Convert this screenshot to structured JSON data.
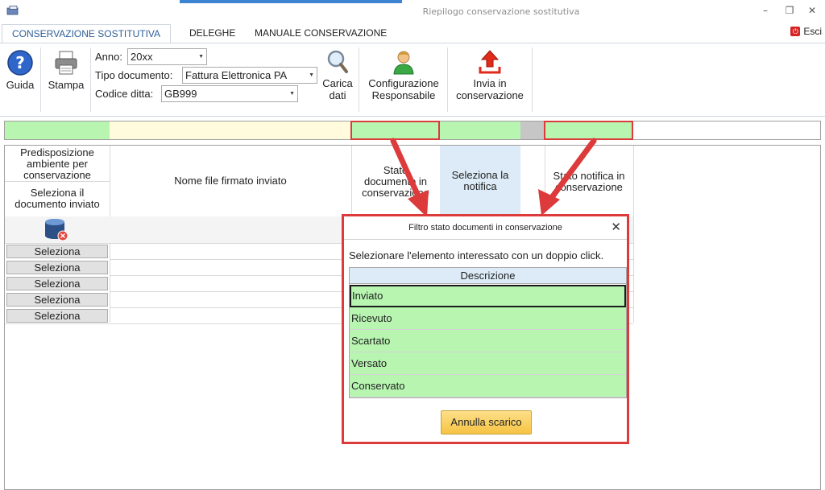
{
  "window": {
    "title": "Riepilogo conservazione sostitutiva",
    "minimize": "–",
    "restore": "❐",
    "close": "✕"
  },
  "tabs": [
    {
      "label": "CONSERVAZIONE SOSTITUTIVA",
      "active": true
    },
    {
      "label": "DELEGHE",
      "active": false
    },
    {
      "label": "MANUALE CONSERVAZIONE",
      "active": false
    }
  ],
  "exit": {
    "label": "Esci",
    "icon": "exit-icon"
  },
  "ribbon": {
    "guida": "Guida",
    "stampa": "Stampa",
    "anno_label": "Anno:",
    "anno_value": "20xx",
    "tipo_label": "Tipo documento:",
    "tipo_value": "Fattura Elettronica PA",
    "codice_label": "Codice ditta:",
    "codice_value": "GB999",
    "carica_line1": "Carica",
    "carica_line2": "dati",
    "config_line1": "Configurazione",
    "config_line2": "Responsabile",
    "invia_line1": "Invia in",
    "invia_line2": "conservazione"
  },
  "grid": {
    "col1_header_top": "Predisposizione ambiente per conservazione",
    "col1_header_bottom": "Seleziona il documento inviato",
    "col2_header": "Nome file firmato inviato",
    "col3_header": "Stato documento in conservazione",
    "col4_header": "Seleziona la notifica",
    "col5_header": "Stato notifica in conservazione",
    "select_buttons": [
      "Seleziona",
      "Seleziona",
      "Seleziona",
      "Seleziona",
      "Seleziona"
    ]
  },
  "dialog": {
    "title": "Filtro stato documenti in conservazione",
    "close": "✕",
    "message": "Selezionare l'elemento interessato con un doppio click.",
    "column_header": "Descrizione",
    "rows": [
      "Inviato",
      "Ricevuto",
      "Scartato",
      "Versato",
      "Conservato"
    ],
    "cancel_button": "Annulla scarico"
  },
  "colors": {
    "accent_blue": "#3c83d2",
    "highlight_red": "#dd3b3b",
    "row_green": "#b7f5b1",
    "filter_yellow": "#fffbdc",
    "button_gold": "#f6c343"
  }
}
